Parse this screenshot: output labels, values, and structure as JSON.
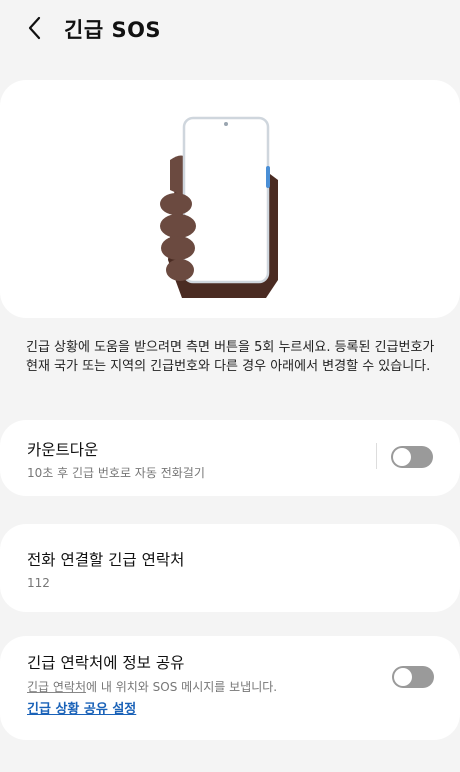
{
  "header": {
    "title": "긴급 SOS",
    "back_icon": "chevron-left-icon"
  },
  "description": "긴급 상황에 도움을 받으려면 측면 버튼을 5회 누르세요. 등록된 긴급번호가 현재 국가 또는 지역의 긴급번호와 다른 경우 아래에서 변경할 수 있습니다.",
  "countdown": {
    "title": "카운트다운",
    "subtitle": "10초 후 긴급 번호로 자동 전화걸기",
    "enabled": false
  },
  "emergency_number": {
    "title": "전화 연결할 긴급 연락처",
    "value": "112"
  },
  "share_info": {
    "title": "긴급 연락처에 정보 공유",
    "subtitle_link_part": "긴급 연락처",
    "subtitle_rest": "에 내 위치와 SOS 메시지를 보냅니다.",
    "settings_link": "긴급 상황 공유 설정",
    "enabled": false
  },
  "colors": {
    "background": "#f4f4f4",
    "card": "#ffffff",
    "link": "#1a62b8",
    "toggle_off": "#9a9a9a",
    "skin": "#6b4a40",
    "sleeve": "#4a2b22"
  }
}
